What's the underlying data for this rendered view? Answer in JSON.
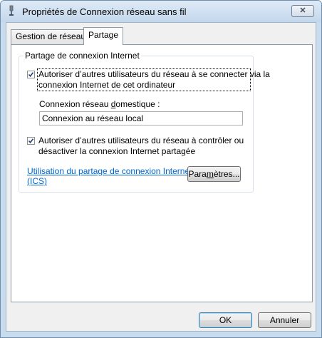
{
  "window": {
    "title": "Propriétés de Connexion réseau sans fil",
    "close_label": "✕",
    "title_icon": "network-adapter-icon"
  },
  "tabs": [
    {
      "label": "Gestion de réseau",
      "active": false
    },
    {
      "label": "Partage",
      "active": true
    }
  ],
  "sharing": {
    "group_label": "Partage de connexion Internet",
    "allow_connect": {
      "checked": true,
      "line1": "Autoriser d’autres utilisateurs du réseau à se connecter via la",
      "line2": "connexion Internet de cet ordinateur"
    },
    "home_connection": {
      "label_before": "Connexion réseau ",
      "label_accel": "d",
      "label_after": "omestique :",
      "value": "Connexion au réseau local"
    },
    "allow_control": {
      "checked": true,
      "line1": "Autoriser d’autres utilisateurs du réseau à contrôler ou",
      "line2": "désactiver la connexion Internet partagée"
    },
    "ics_link": {
      "line1": "Utilisation du partage de connexion Internet",
      "line2": "(ICS)"
    },
    "settings_button": {
      "before": "Para",
      "accel": "m",
      "after": "ètres..."
    }
  },
  "footer": {
    "ok_label": "OK",
    "cancel_label": "Annuler"
  }
}
